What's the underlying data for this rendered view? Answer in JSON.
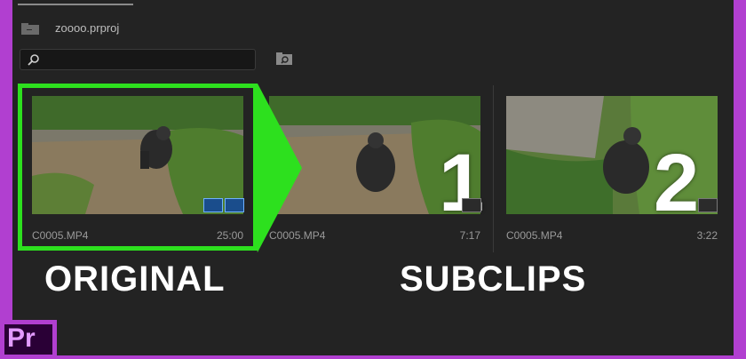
{
  "project": {
    "name": "zoooo.prproj"
  },
  "search": {
    "placeholder": ""
  },
  "clips": [
    {
      "name": "C0005.MP4",
      "duration": "25:00",
      "selected": true
    },
    {
      "name": "C0005.MP4",
      "duration": "7:17",
      "label": "1"
    },
    {
      "name": "C0005.MP4",
      "duration": "3:22",
      "label": "2"
    }
  ],
  "captions": {
    "original": "ORIGINAL",
    "subclips": "SUBCLIPS"
  },
  "logo": {
    "text": "Pr"
  },
  "colors": {
    "frame": "#2de01e",
    "border": "#b13fd0",
    "panel": "#232323"
  }
}
